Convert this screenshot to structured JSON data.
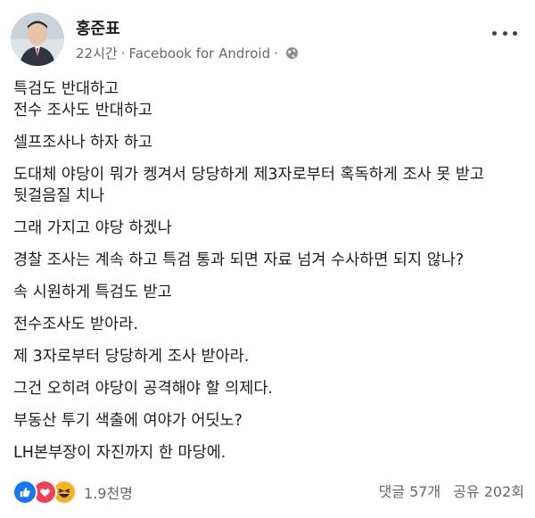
{
  "post": {
    "author": "홍준표",
    "time": "22시간",
    "separator": "·",
    "source": "Facebook for Android",
    "separator2": "·",
    "privacy_icon": "globe-icon",
    "lines": [
      "특검도 반대하고",
      "전수 조사도 반대하고",
      "셀프조사나 하자 하고",
      "도대체 야당이 뭐가 켕겨서 당당하게 제3자로부터 혹독하게 조사 못 받고 뒷걸음질 치나",
      "그래 가지고 야당 하겠나",
      "경찰 조사는 계속 하고 특검 통과 되면 자료 넘겨 수사하면 되지 않나?",
      "속 시원하게 특검도 받고",
      "전수조사도 받아라.",
      "제 3자로부터 당당하게 조사 받아라.",
      "그건 오히려 야당이 공격해야 할 의제다.",
      "부동산 투기 색출에 여야가 어딧노?",
      "LH본부장이 자진까지 한 마당에."
    ]
  },
  "footer": {
    "reaction_icons": [
      "like-icon",
      "love-icon",
      "haha-icon"
    ],
    "reaction_count": "1.9천명",
    "comments": "댓글 57개",
    "shares": "공유 202회"
  },
  "colors": {
    "like": "#1877f2",
    "love": "#f33e58",
    "haha": "#f7b125",
    "meta": "#65676b",
    "text": "#1c1e21"
  }
}
